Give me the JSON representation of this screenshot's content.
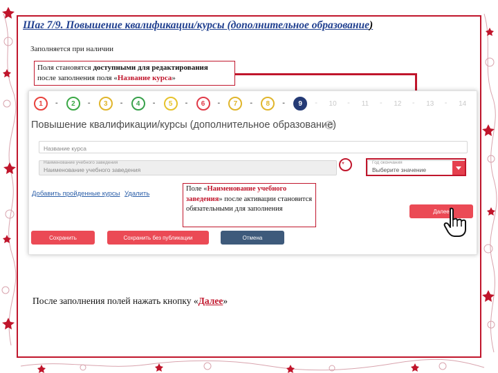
{
  "slide": {
    "title_main": "Шаг 7/9. Повышение квалификации/курсы (дополнительное образование",
    "title_close": ")",
    "fill_note": "Заполняется при наличии",
    "bottom_note_before": "После заполнения полей нажать кнопку «",
    "bottom_note_bold": "Далее",
    "bottom_note_after": "»"
  },
  "callouts": {
    "top": {
      "t1": "Поля становятся ",
      "t1b": "доступными для редактирования",
      "t2": "после заполнения поля «",
      "t2b": "Название курса",
      "t2c": "»"
    },
    "middle": {
      "t1": "Поле «",
      "t1b": "Наименование учебного заведения",
      "t2": "» после активации становится обязательными для заполнения"
    }
  },
  "stepper": {
    "steps": [
      "1",
      "2",
      "3",
      "4",
      "5",
      "6",
      "7",
      "8",
      "9",
      "10",
      "11",
      "12",
      "13",
      "14"
    ],
    "current": "9",
    "colors": [
      "#e8413c",
      "#3aa845",
      "#e0b52b",
      "#37a04a",
      "#e6c22b",
      "#e03a48",
      "#e0b52b",
      "#e0b52b"
    ]
  },
  "form": {
    "title": "Повышение квалификации/курсы (дополнительное образование)",
    "help_icon": "?",
    "course_name_placeholder": "Название курса",
    "institution_label": "Наименование учебного заведения",
    "institution_value": "Наименование учебного заведения",
    "required_mark": "*",
    "year_label": "Год окончания",
    "year_value": "Выберите значение",
    "add_courses_link": "Добавить пройденные курсы",
    "delete_link": "Удалить",
    "next_button": "Далее",
    "save_button": "Сохранить",
    "save_no_publish_button": "Сохранить без публикации",
    "cancel_button": "Отмена"
  },
  "colors": {
    "accent_red": "#c0152b",
    "button_red": "#eb4a55",
    "button_dark": "#3e5a7b",
    "current_step": "#243a75",
    "title_blue": "#1f3f8f"
  }
}
